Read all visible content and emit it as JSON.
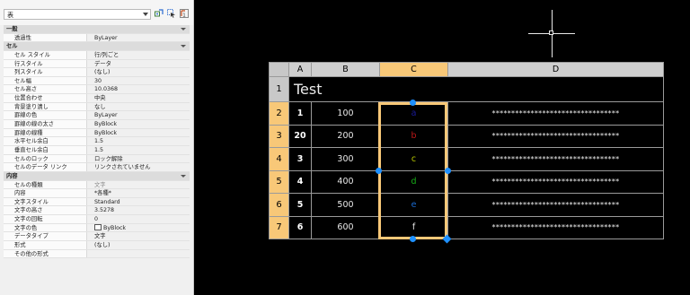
{
  "palette": {
    "object_type": "表",
    "categories": [
      {
        "title": "一般",
        "rows": [
          {
            "label": "透過性",
            "value": "ByLayer"
          }
        ]
      },
      {
        "title": "セル",
        "rows": [
          {
            "label": "セル スタイル",
            "value": "行/列ごと"
          },
          {
            "label": "行スタイル",
            "value": "データ"
          },
          {
            "label": "列スタイル",
            "value": "(なし)"
          },
          {
            "label": "セル幅",
            "value": "30"
          },
          {
            "label": "セル高さ",
            "value": "10.0368"
          },
          {
            "label": "位置合わせ",
            "value": "中央"
          },
          {
            "label": "背景塗り潰し",
            "value": "なし"
          },
          {
            "label": "罫線の色",
            "value": "ByLayer"
          },
          {
            "label": "罫線の線の太さ",
            "value": "ByBlock"
          },
          {
            "label": "罫線の線種",
            "value": "ByBlock"
          },
          {
            "label": "水平セル余白",
            "value": "1.5"
          },
          {
            "label": "垂直セル余白",
            "value": "1.5"
          },
          {
            "label": "セルのロック",
            "value": "ロック解除"
          },
          {
            "label": "セルのデータ リンク",
            "value": "リンクされていません"
          }
        ]
      },
      {
        "title": "内容",
        "rows": [
          {
            "label": "セルの種類",
            "value": "文字",
            "gray": true
          },
          {
            "label": "内容",
            "value": "*各種*"
          },
          {
            "label": "文字スタイル",
            "value": "Standard"
          },
          {
            "label": "文字の高さ",
            "value": "3.5278"
          },
          {
            "label": "文字の回転",
            "value": "0"
          },
          {
            "label": "文字の色",
            "value": "ByBlock",
            "swatch": true
          },
          {
            "label": "データタイプ",
            "value": "文字"
          },
          {
            "label": "形式",
            "value": "(なし)"
          },
          {
            "label": "その他の形式",
            "value": ""
          }
        ]
      }
    ]
  },
  "table": {
    "column_headers": [
      "A",
      "B",
      "C",
      "D"
    ],
    "selected_column": "C",
    "title_row_number": "1",
    "title": "Test",
    "rows": [
      {
        "n": "2",
        "a": "1",
        "b": "100",
        "c": "a",
        "c_color": "#1a1a9a",
        "d": "*********************************"
      },
      {
        "n": "3",
        "a": "20",
        "b": "200",
        "c": "b",
        "c_color": "#c01818",
        "d": "*********************************"
      },
      {
        "n": "4",
        "a": "3",
        "b": "300",
        "c": "c",
        "c_color": "#b8c800",
        "d": "*********************************"
      },
      {
        "n": "5",
        "a": "4",
        "b": "400",
        "c": "d",
        "c_color": "#18b018",
        "d": "*********************************"
      },
      {
        "n": "6",
        "a": "5",
        "b": "500",
        "c": "e",
        "c_color": "#1a6ad0",
        "d": "*********************************"
      },
      {
        "n": "7",
        "a": "6",
        "b": "600",
        "c": "f",
        "c_color": "#e8e8e8",
        "d": "*********************************"
      }
    ]
  },
  "icons": {
    "quick_select": "quick-select-icon",
    "select_objects": "select-objects-icon",
    "pickadd": "pickadd-toggle-icon"
  }
}
